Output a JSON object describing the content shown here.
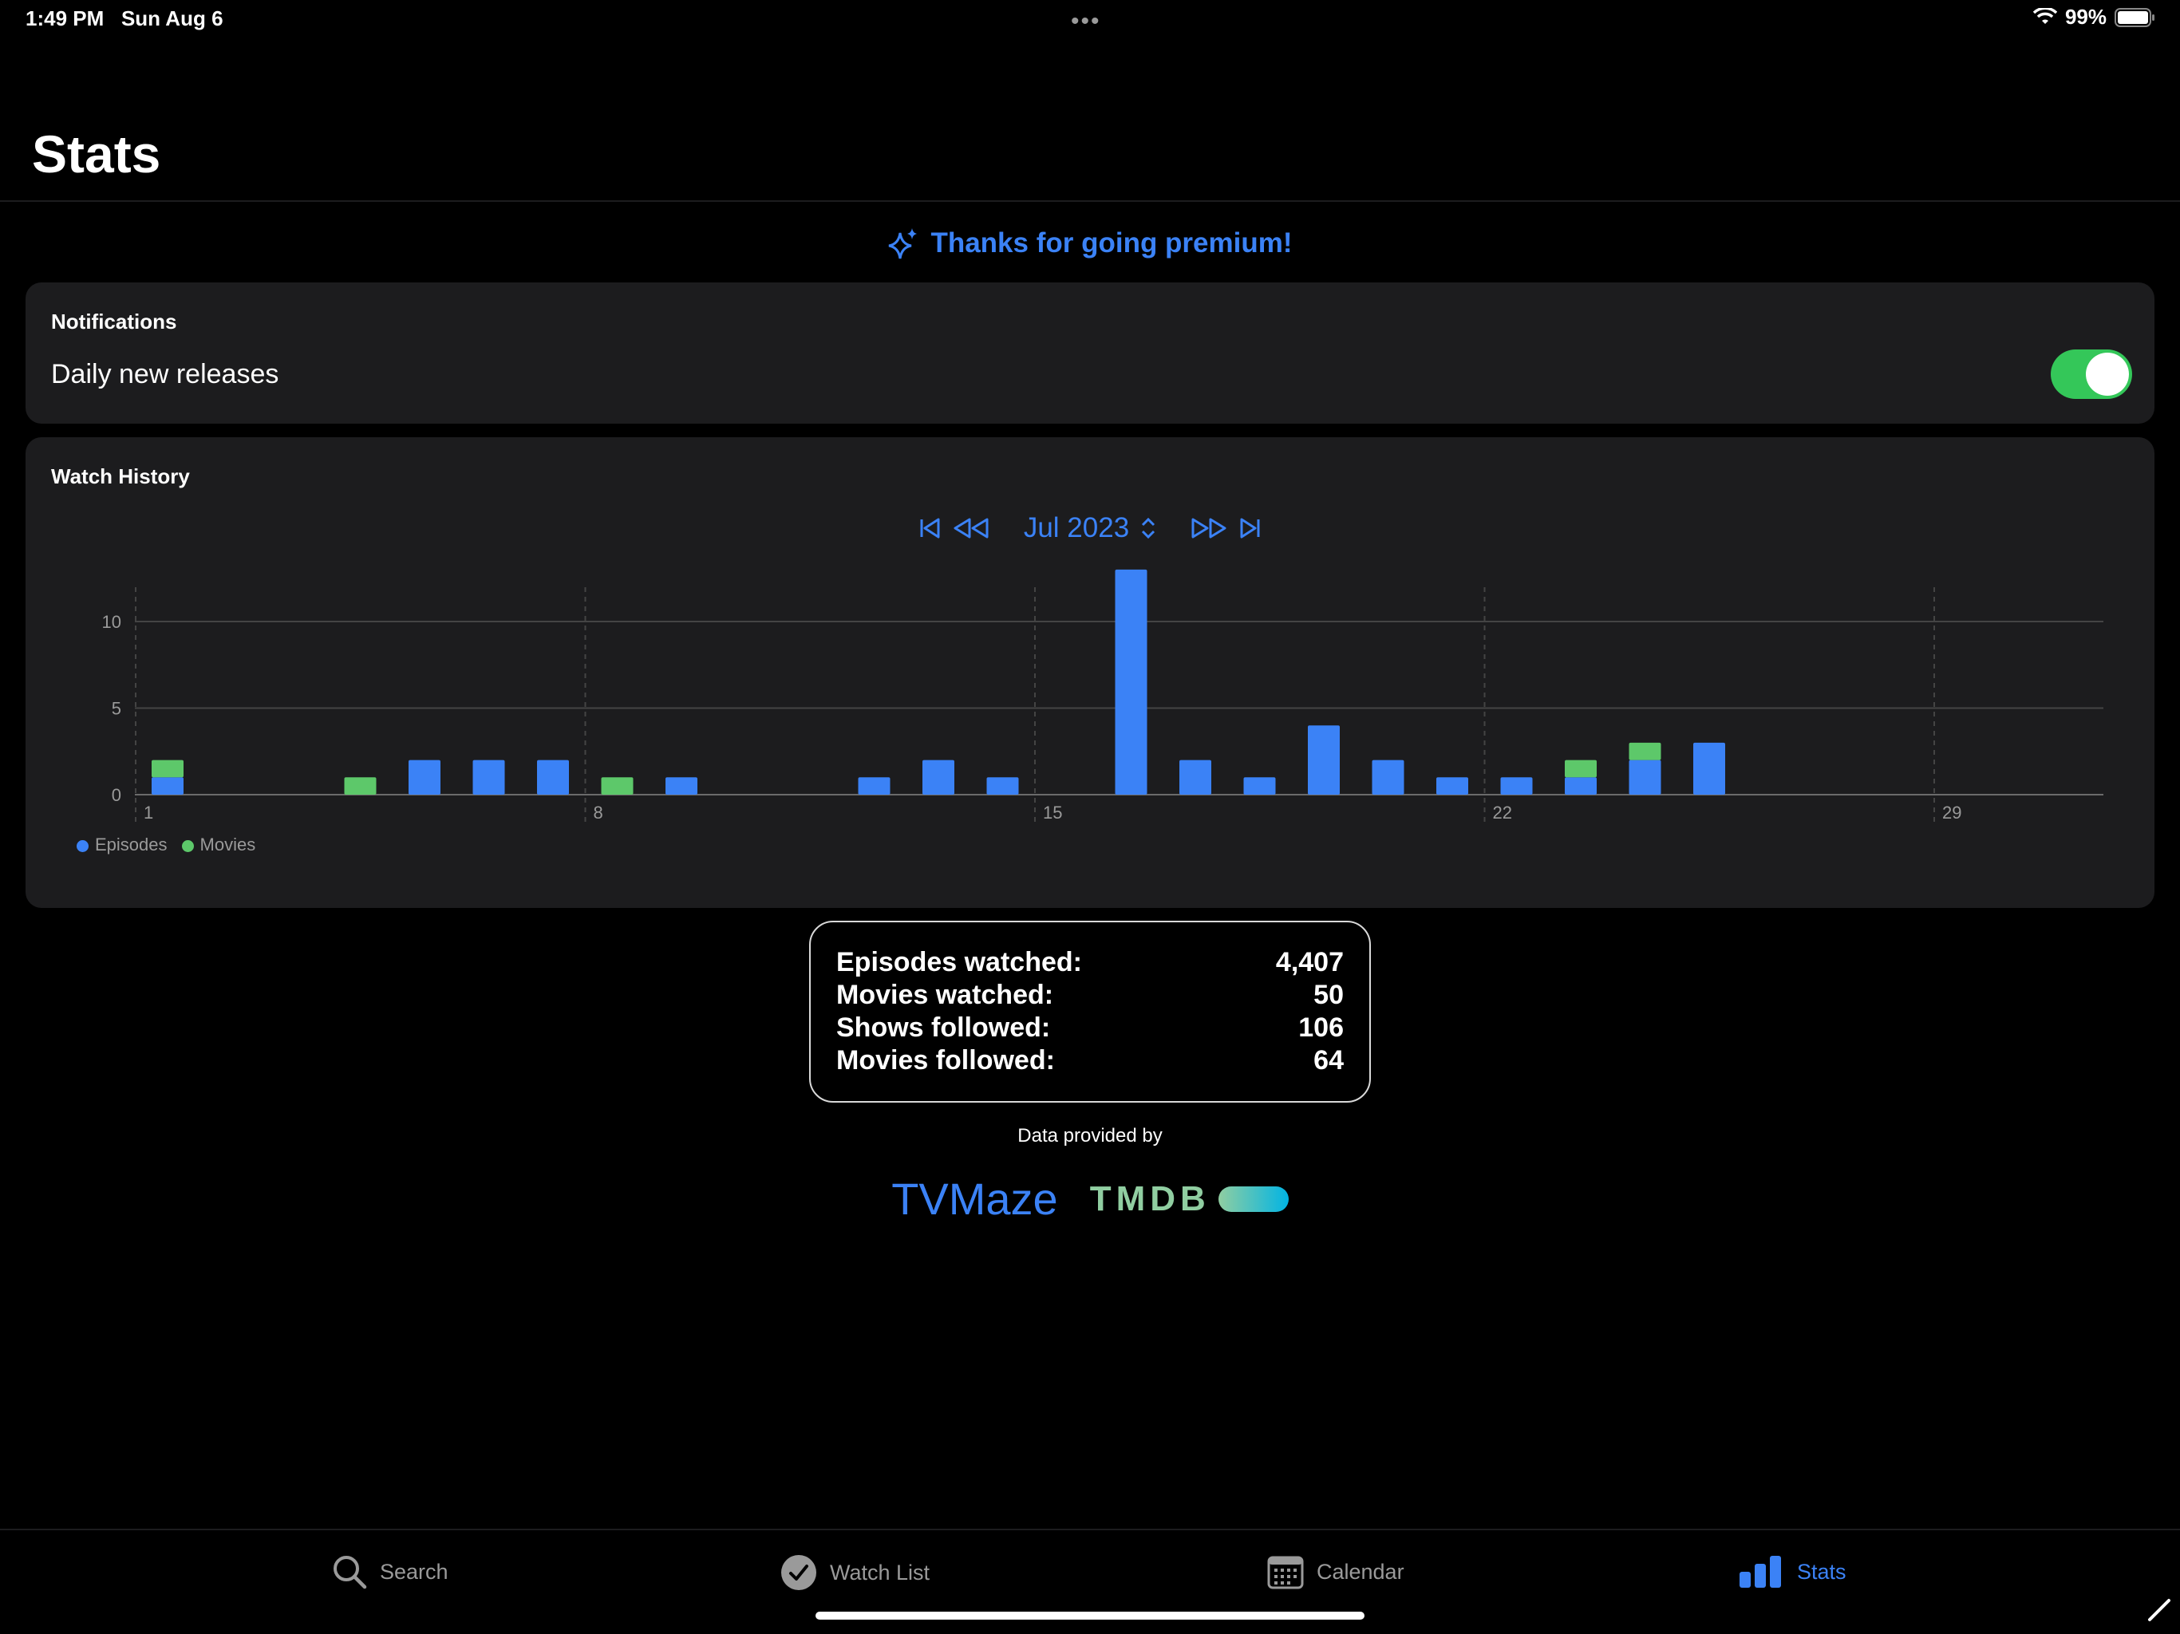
{
  "status_bar": {
    "time": "1:49 PM",
    "date": "Sun Aug 6",
    "battery": "99%"
  },
  "page": {
    "title": "Stats"
  },
  "premium": {
    "label": "Thanks for going premium!"
  },
  "notifications": {
    "header": "Notifications",
    "row_label": "Daily new releases",
    "toggle_on": true
  },
  "watch_history": {
    "header": "Watch History",
    "month_label": "Jul 2023",
    "legend": {
      "episodes": "Episodes",
      "movies": "Movies"
    }
  },
  "colors": {
    "episodes": "#3b82f6",
    "movies": "#5dc86a",
    "accent": "#3b82f6"
  },
  "chart_data": {
    "type": "bar",
    "stacked": true,
    "x": [
      1,
      2,
      3,
      4,
      5,
      6,
      7,
      8,
      9,
      10,
      11,
      12,
      13,
      14,
      15,
      16,
      17,
      18,
      19,
      20,
      21,
      22,
      23,
      24,
      25,
      26,
      27,
      28,
      29,
      30,
      31
    ],
    "series": [
      {
        "name": "Episodes",
        "values": [
          1,
          0,
          0,
          0,
          2,
          2,
          2,
          0,
          1,
          0,
          0,
          1,
          2,
          1,
          0,
          13,
          2,
          1,
          4,
          2,
          1,
          1,
          1,
          2,
          3,
          0,
          0,
          0,
          0,
          0,
          0
        ]
      },
      {
        "name": "Movies",
        "values": [
          1,
          0,
          0,
          1,
          0,
          0,
          0,
          1,
          0,
          0,
          0,
          0,
          0,
          0,
          0,
          0,
          0,
          0,
          0,
          0,
          0,
          0,
          1,
          1,
          0,
          0,
          0,
          0,
          0,
          0,
          0
        ]
      }
    ],
    "x_ticks": [
      "1",
      "8",
      "15",
      "22",
      "29"
    ],
    "y_ticks": [
      "0",
      "5",
      "10"
    ],
    "ylim": [
      0,
      14
    ],
    "grid": true,
    "legend_position": "bottom-left"
  },
  "totals": [
    {
      "label": "Episodes watched:",
      "value": "4,407"
    },
    {
      "label": "Movies watched:",
      "value": "50"
    },
    {
      "label": "Shows followed:",
      "value": "106"
    },
    {
      "label": "Movies followed:",
      "value": "64"
    }
  ],
  "providers": {
    "caption": "Data provided by",
    "tvmaze": "TVMaze",
    "tmdb": "TMDB"
  },
  "tabs": [
    {
      "label": "Search",
      "icon": "search-icon"
    },
    {
      "label": "Watch List",
      "icon": "checkmark-circle-icon"
    },
    {
      "label": "Calendar",
      "icon": "calendar-icon"
    },
    {
      "label": "Stats",
      "icon": "bar-chart-icon",
      "active": true
    }
  ]
}
